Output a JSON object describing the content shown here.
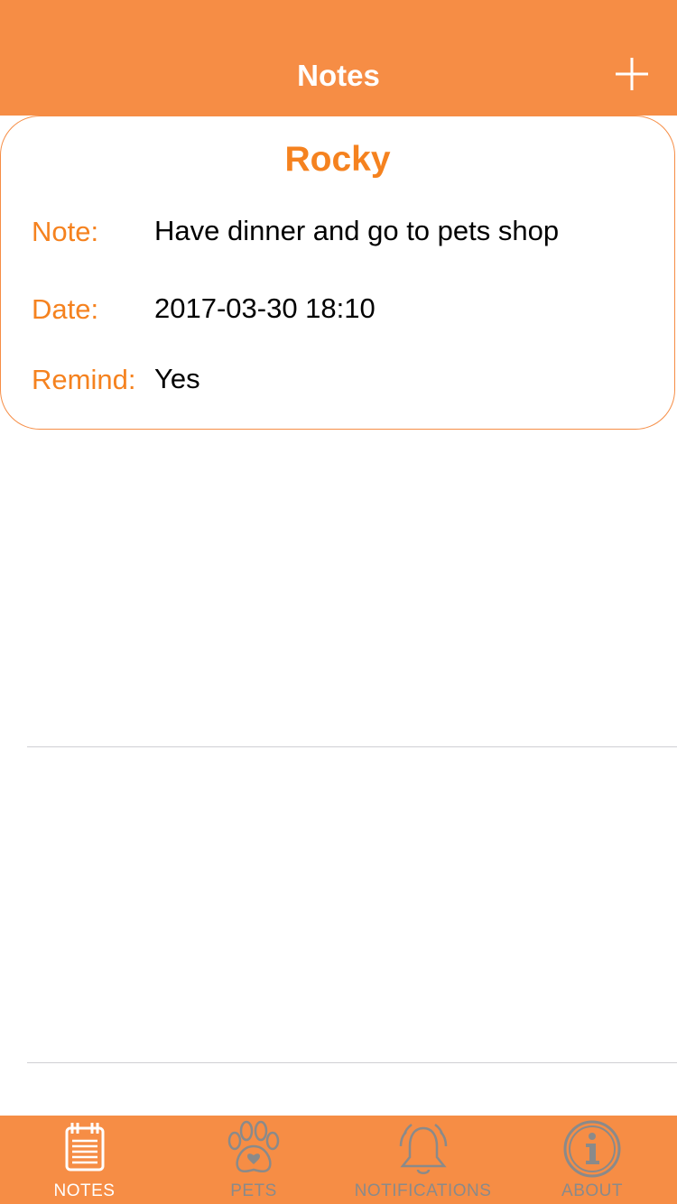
{
  "nav": {
    "title": "Notes",
    "add_icon": "plus-icon"
  },
  "note": {
    "pet_name": "Rocky",
    "note_label": "Note:",
    "note_value": "Have dinner and go to pets shop",
    "date_label": "Date:",
    "date_value": "2017-03-30 18:10",
    "remind_label": "Remind:",
    "remind_value": "Yes"
  },
  "tabs": [
    {
      "label": "NOTES",
      "icon": "notepad-icon",
      "active": true
    },
    {
      "label": "PETS",
      "icon": "paw-icon",
      "active": false
    },
    {
      "label": "NOTIFICATIONS",
      "icon": "bell-icon",
      "active": false
    },
    {
      "label": "ABOUT",
      "icon": "info-icon",
      "active": false
    }
  ],
  "colors": {
    "brand": "#F68D45",
    "accent_text": "#F5821F",
    "tab_inactive": "#8a8a8a",
    "tab_active": "#ffffff"
  }
}
